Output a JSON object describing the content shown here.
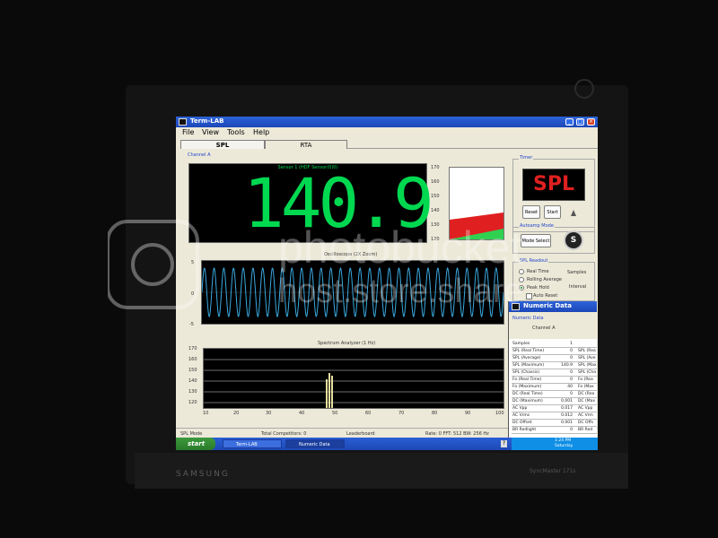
{
  "window": {
    "title": "Term-LAB"
  },
  "menu": [
    "File",
    "View",
    "Tools",
    "Help"
  ],
  "tabs": [
    "SPL",
    "RTA"
  ],
  "channel_label": "Channel A",
  "display": {
    "sensor": "Sensor 1 (HDF Sensor(0)0)",
    "value": "140.9"
  },
  "bar_scale": [
    "170",
    "160",
    "150",
    "140",
    "130",
    "120"
  ],
  "bar_meter": {
    "value": 140.9,
    "min": 120,
    "max": 170
  },
  "oscilloscope": {
    "title": "Oscilloscope (2X Zoom)",
    "y_labels": [
      "5",
      "0",
      "-5"
    ]
  },
  "spectrum": {
    "title": "Spectrum Analyzer (1 Hz)",
    "y_labels": [
      "170",
      "160",
      "150",
      "140",
      "130",
      "120"
    ],
    "x_labels": [
      "10",
      "20",
      "30",
      "40",
      "50",
      "60",
      "70",
      "80",
      "90",
      "100"
    ]
  },
  "timer": {
    "label": "Timer",
    "display": "SPL",
    "reset": "Reset",
    "start": "Start"
  },
  "autoamp": {
    "label": "Autoamp Mode",
    "mode_select": "Mode Select"
  },
  "spl_readout": {
    "label": "SPL Readout",
    "options": [
      "Real Time",
      "Rolling Average",
      "Peak Hold",
      "Auto Reset"
    ],
    "samples": "Samples",
    "interval": "Interval"
  },
  "status": {
    "mode": "SPL Mode",
    "competitors": "Total Competitors: 0",
    "leaderboard": "Leaderboard",
    "rate": "Rate: 0 FFT: 512 BW: 256 Hz"
  },
  "numeric": {
    "title": "Numeric Data",
    "subtitle": "Numeric Data",
    "channel": "Channel A",
    "header": {
      "key": "Samples",
      "value": "1"
    },
    "rows": [
      {
        "key": "SPL (Real Time)",
        "value": "0",
        "key2": "SPL (Rea"
      },
      {
        "key": "SPL (Average)",
        "value": "0",
        "key2": "SPL (Ave"
      },
      {
        "key": "SPL (Maximum)",
        "value": "140.9",
        "key2": "SPL (Max"
      },
      {
        "key": "SPL (Chassis)",
        "value": "0",
        "key2": "SPL (Cha"
      },
      {
        "key": "Fo (Real Time)",
        "value": "0",
        "key2": "Fo (Rea"
      },
      {
        "key": "Fo (Maximum)",
        "value": "40",
        "key2": "Fo (Max"
      },
      {
        "key": "DC (Real Time)",
        "value": "0",
        "key2": "DC (Rea"
      },
      {
        "key": "DC (Maximum)",
        "value": "0.001",
        "key2": "DC (Max"
      },
      {
        "key": "AC Vpp",
        "value": "0.017",
        "key2": "AC Vpp"
      },
      {
        "key": "AC Vrms",
        "value": "0.012",
        "key2": "AC Vrm"
      },
      {
        "key": "DC Offset",
        "value": "0.001",
        "key2": "DC Offs"
      },
      {
        "key": "BR Redlight",
        "value": "0",
        "key2": "BR Red"
      }
    ]
  },
  "taskbar": {
    "start": "start",
    "items": [
      "Term-LAB",
      "Numeric Data"
    ],
    "time": "1:24 PM",
    "day": "Saturday"
  },
  "monitor": {
    "brand": "SAMSUNG",
    "model": "SyncMaster 171s"
  },
  "watermark": {
    "text": "photobucket",
    "subtext": "host.store.share"
  },
  "colors": {
    "digits": "#00d850",
    "waveform": "#39a9e0",
    "spl_red": "#e02020",
    "meter_green": "#30d050",
    "titlebar": "#2d63d8"
  }
}
